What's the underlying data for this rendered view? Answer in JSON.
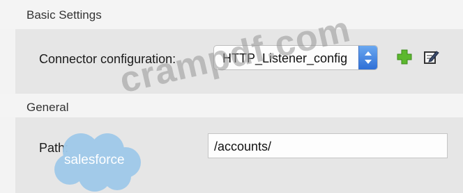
{
  "basic_settings": {
    "title": "Basic Settings",
    "connector_label": "Connector configuration:",
    "connector_value": "HTTP_Listener_config"
  },
  "general": {
    "title": "General",
    "path_label": "Path:",
    "path_value": "/accounts/"
  },
  "icons": {
    "add": "plus-icon",
    "edit": "edit-icon",
    "stepper": "stepper-icon"
  },
  "watermark": "crampdf.com",
  "logo": "salesforce",
  "colors": {
    "stepper_blue": "#2f6fd6",
    "add_green": "#5cb82e",
    "logo_blue": "#9fc9ea"
  }
}
